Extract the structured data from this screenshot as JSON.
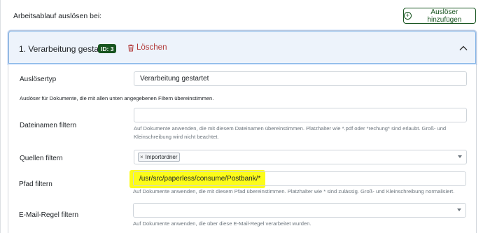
{
  "header": {
    "section_title": "Arbeitsablauf auslösen bei:",
    "add_button_label": "Auslöser hinzufügen"
  },
  "trigger": {
    "title": "1. Verarbeitung gestartet",
    "id_badge": "ID: 3",
    "delete_label": "Löschen",
    "type_label": "Auslösertyp",
    "type_value": "Verarbeitung gestartet",
    "note": "Auslöser für Dokumente, die mit allen unten angegebenen Filtern übereinstimmen.",
    "filename": {
      "label": "Dateinamen filtern",
      "value": "",
      "help": "Auf Dokumente anwenden, die mit diesem Dateinamen übereinstimmen. Platzhalter wie *.pdf oder *rechung* sind erlaubt. Groß- und Kleinschreibung wird nicht beachtet."
    },
    "sources": {
      "label": "Quellen filtern",
      "tags": [
        "Importordner"
      ]
    },
    "path": {
      "label": "Pfad filtern",
      "value": "/usr/src/paperless/consume/Postbank/*",
      "help": "Auf Dokumente anwenden, die mit diesem Pfad übereinstimmen. Platzhalter wie * sind zulässig. Groß- und Kleinschreibung normalisiert."
    },
    "mailrule": {
      "label": "E-Mail-Regel filtern",
      "value": "",
      "help": "Auf Dokumente anwenden, die über diese E-Mail-Regel verarbeitet wurden."
    }
  },
  "colors": {
    "primary": "#17541f",
    "danger": "#b23a3a",
    "highlight": "#fcfc1a",
    "header_bg": "#edf3fb"
  },
  "icons": [
    "plus-circle-icon",
    "trash-icon",
    "chevron-up-icon",
    "dropdown-arrow-icon",
    "remove-tag-icon"
  ]
}
